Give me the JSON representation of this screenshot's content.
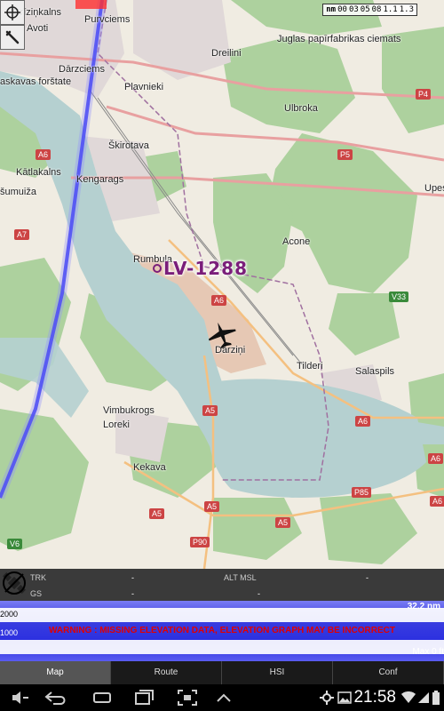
{
  "map": {
    "scale_unit": "nm",
    "scale_ticks": [
      "00",
      "03",
      "05",
      "08",
      "1.1",
      "1.3"
    ],
    "flight_id": "LV-1288",
    "places": [
      "Grīziņkalns",
      "Purvciems",
      "Avoti",
      "Juglas papīrfabrikas ciemats",
      "Dreilini",
      "Dārzciems",
      "Plavnieki",
      "askavas forštate",
      "Ulbroka",
      "Škirotava",
      "Kātlakalns",
      "Kengarags",
      "šumuiža",
      "Acone",
      "Upes",
      "Rumbula",
      "Dārziņi",
      "Tilderi",
      "Salaspils",
      "Vimbukrogs",
      "Loreki",
      "Kekava"
    ],
    "shields": [
      "P4",
      "P5",
      "A6",
      "A7",
      "A6",
      "A5",
      "V33",
      "A6",
      "A5",
      "A5",
      "A5",
      "P85",
      "P90",
      "V6",
      "A6",
      "A6"
    ]
  },
  "info": {
    "trk_label": "TRK",
    "trk_value": "-",
    "gs_label": "GS",
    "gs_value": "-",
    "alt_label": "ALT MSL",
    "alt_value": "-",
    "right_value": "-"
  },
  "graph": {
    "tick_2000": "2000",
    "tick_1000": "1000",
    "distance": "32.2 nm",
    "warning": "WARNING : MISSING ELEVATION DATA, ELEVATION GRAPH MAY BE INCORRECT",
    "max": "Max 0 ft"
  },
  "tabs": [
    "Map",
    "Route",
    "HSI",
    "Conf"
  ],
  "active_tab": "Map",
  "system": {
    "time": "21:58"
  },
  "colors": {
    "route": "#3030f0",
    "flight_label": "#7a1e7a",
    "warning": "#e00000",
    "water": "#b5d0d0",
    "forest": "#add19e"
  }
}
